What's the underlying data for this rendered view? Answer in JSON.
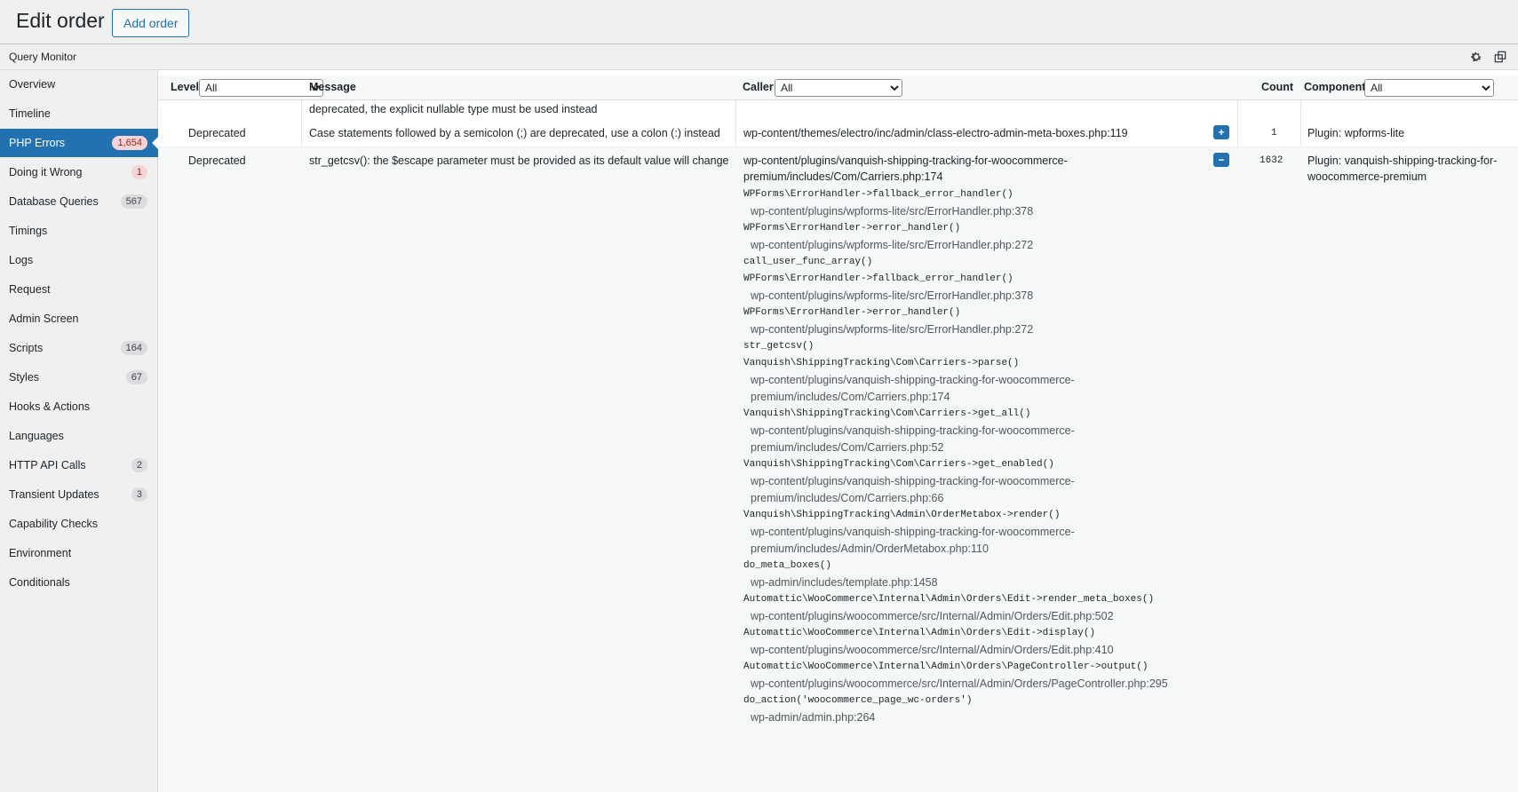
{
  "page": {
    "title": "Edit order",
    "add_button": "Add order"
  },
  "qm": {
    "title": "Query Monitor"
  },
  "sidebar": {
    "items": [
      {
        "label": "Overview"
      },
      {
        "label": "Timeline"
      },
      {
        "label": "PHP Errors",
        "badge": "1,654",
        "active": true
      },
      {
        "label": "Doing it Wrong",
        "badge": "1"
      },
      {
        "label": "Database Queries",
        "badge": "567"
      },
      {
        "label": "Timings"
      },
      {
        "label": "Logs"
      },
      {
        "label": "Request"
      },
      {
        "label": "Admin Screen"
      },
      {
        "label": "Scripts",
        "badge": "164"
      },
      {
        "label": "Styles",
        "badge": "67"
      },
      {
        "label": "Hooks & Actions"
      },
      {
        "label": "Languages"
      },
      {
        "label": "HTTP API Calls",
        "badge": "2"
      },
      {
        "label": "Transient Updates",
        "badge": "3"
      },
      {
        "label": "Capability Checks"
      },
      {
        "label": "Environment"
      },
      {
        "label": "Conditionals"
      }
    ]
  },
  "table": {
    "headers": {
      "level": "Level",
      "message": "Message",
      "caller": "Caller",
      "count": "Count",
      "component": "Component"
    },
    "filters": {
      "level": "All",
      "caller": "All",
      "component": "All"
    },
    "partial_message": "deprecated, the explicit nullable type must be used instead",
    "rows": [
      {
        "level": "Deprecated",
        "message": "Case statements followed by a semicolon (;) are deprecated, use a colon (:) instead",
        "caller": "wp-content/themes/electro/inc/admin/class-electro-admin-meta-boxes.php:119",
        "toggle": "+",
        "count": "1",
        "component": "Plugin: wpforms-lite"
      },
      {
        "level": "Deprecated",
        "message": "str_getcsv(): the $escape parameter must be provided as its default value will change",
        "caller": "wp-content/plugins/vanquish-shipping-tracking-for-woocommerce-premium/includes/Com/Carriers.php:174",
        "toggle": "−",
        "count": "1632",
        "component": "Plugin: vanquish-shipping-tracking-for-woocommerce-premium",
        "trace": [
          {
            "type": "fn",
            "text": "WPForms\\ErrorHandler->fallback_error_handler()"
          },
          {
            "type": "file",
            "text": "wp-content/plugins/wpforms-lite/src/ErrorHandler.php:378"
          },
          {
            "type": "fn",
            "text": "WPForms\\ErrorHandler->error_handler()"
          },
          {
            "type": "file",
            "text": "wp-content/plugins/wpforms-lite/src/ErrorHandler.php:272"
          },
          {
            "type": "fn",
            "text": "call_user_func_array()"
          },
          {
            "type": "fn",
            "text": "WPForms\\ErrorHandler->fallback_error_handler()"
          },
          {
            "type": "file",
            "text": "wp-content/plugins/wpforms-lite/src/ErrorHandler.php:378"
          },
          {
            "type": "fn",
            "text": "WPForms\\ErrorHandler->error_handler()"
          },
          {
            "type": "file",
            "text": "wp-content/plugins/wpforms-lite/src/ErrorHandler.php:272"
          },
          {
            "type": "fn",
            "text": "str_getcsv()"
          },
          {
            "type": "fn",
            "text": "Vanquish\\ShippingTracking\\Com\\Carriers->parse()"
          },
          {
            "type": "file",
            "text": "wp-content/plugins/vanquish-shipping-tracking-for-woocommerce-premium/includes/Com/Carriers.php:174"
          },
          {
            "type": "fn",
            "text": "Vanquish\\ShippingTracking\\Com\\Carriers->get_all()"
          },
          {
            "type": "file",
            "text": "wp-content/plugins/vanquish-shipping-tracking-for-woocommerce-premium/includes/Com/Carriers.php:52"
          },
          {
            "type": "fn",
            "text": "Vanquish\\ShippingTracking\\Com\\Carriers->get_enabled()"
          },
          {
            "type": "file",
            "text": "wp-content/plugins/vanquish-shipping-tracking-for-woocommerce-premium/includes/Com/Carriers.php:66"
          },
          {
            "type": "fn",
            "text": "Vanquish\\ShippingTracking\\Admin\\OrderMetabox->render()"
          },
          {
            "type": "file",
            "text": "wp-content/plugins/vanquish-shipping-tracking-for-woocommerce-premium/includes/Admin/OrderMetabox.php:110"
          },
          {
            "type": "fn",
            "text": "do_meta_boxes()"
          },
          {
            "type": "file",
            "text": "wp-admin/includes/template.php:1458"
          },
          {
            "type": "fn",
            "text": "Automattic\\WooCommerce\\Internal\\Admin\\Orders\\Edit->render_meta_boxes()"
          },
          {
            "type": "file",
            "text": "wp-content/plugins/woocommerce/src/Internal/Admin/Orders/Edit.php:502"
          },
          {
            "type": "fn",
            "text": "Automattic\\WooCommerce\\Internal\\Admin\\Orders\\Edit->display()"
          },
          {
            "type": "file",
            "text": "wp-content/plugins/woocommerce/src/Internal/Admin/Orders/Edit.php:410"
          },
          {
            "type": "fn",
            "text": "Automattic\\WooCommerce\\Internal\\Admin\\Orders\\PageController->output()"
          },
          {
            "type": "file",
            "text": "wp-content/plugins/woocommerce/src/Internal/Admin/Orders/PageController.php:295"
          },
          {
            "type": "fn",
            "text": "do_action('woocommerce_page_wc-orders')"
          },
          {
            "type": "file",
            "text": "wp-admin/admin.php:264"
          }
        ]
      }
    ]
  }
}
